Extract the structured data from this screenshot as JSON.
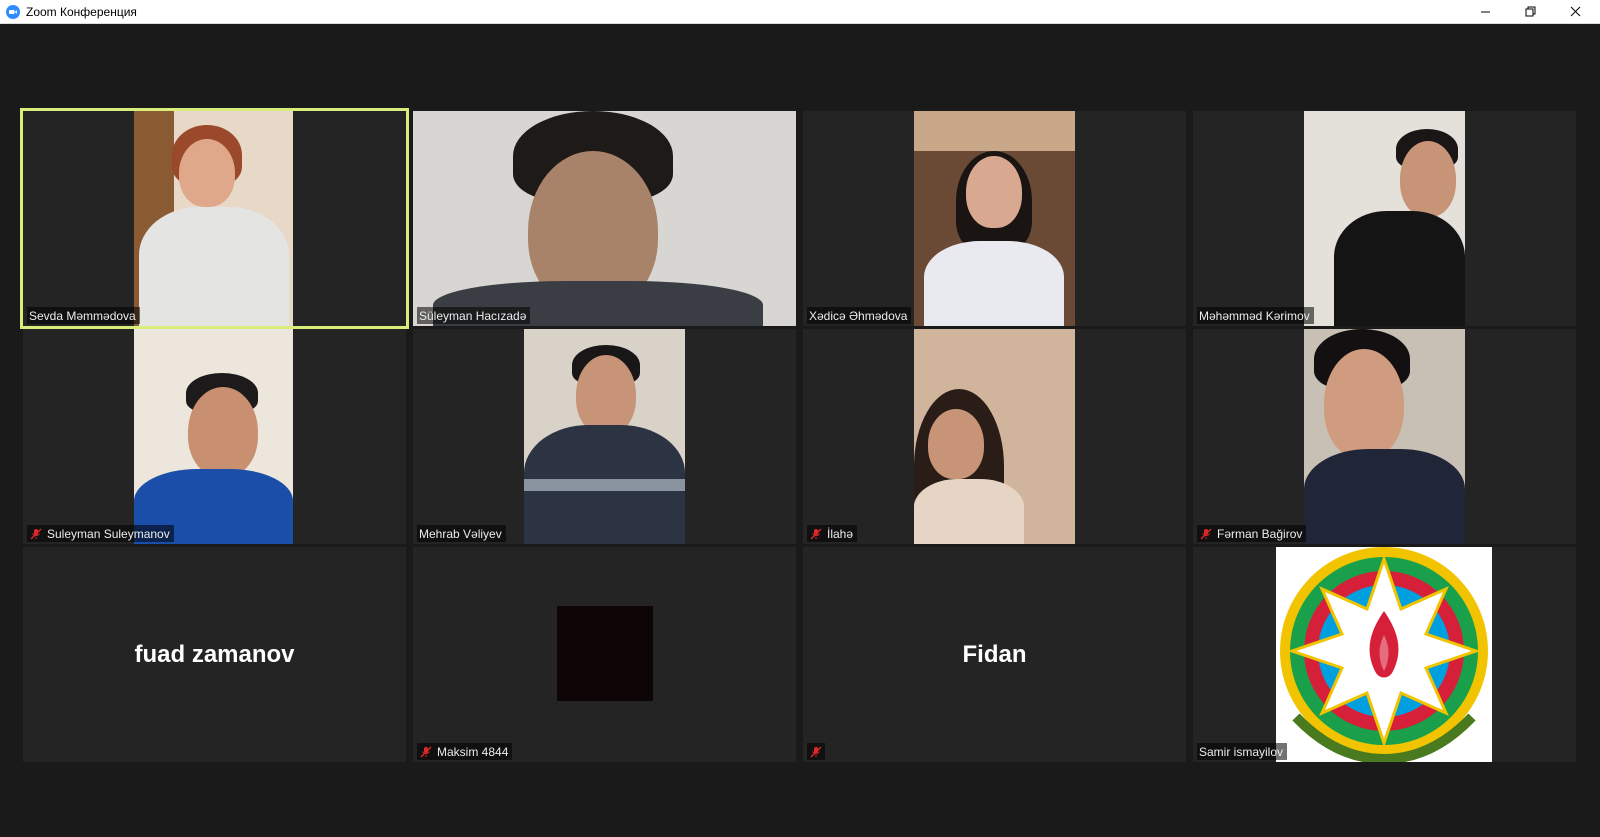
{
  "window": {
    "title": "Zoom Конференция",
    "controls": [
      "minimize-icon",
      "restore-icon",
      "close-icon"
    ]
  },
  "colors": {
    "active_speaker_border": "#d8ee7a",
    "mute_icon": "#e02828",
    "zoom_blue": "#2d8cff"
  },
  "participants": [
    {
      "name": "Sevda Məmmədova",
      "muted": false,
      "video": true,
      "active_speaker": true
    },
    {
      "name": "Süleyman Hacızadə",
      "muted": false,
      "video": true
    },
    {
      "name": "Xədicə Əhmədova",
      "muted": false,
      "video": true
    },
    {
      "name": "Məhəmməd Kərimov",
      "muted": false,
      "video": true
    },
    {
      "name": "Suleyman Suleymanov",
      "muted": true,
      "video": true
    },
    {
      "name": "Mehrab Vəliyev",
      "muted": false,
      "video": true
    },
    {
      "name": "İlahə",
      "muted": true,
      "video": true
    },
    {
      "name": "Fərman Bağirov",
      "muted": true,
      "video": true
    },
    {
      "name": "fuad zamanov",
      "muted": false,
      "video": false
    },
    {
      "name": "Maksim 4844",
      "muted": true,
      "video": true
    },
    {
      "name": "Fidan",
      "muted": true,
      "video": false
    },
    {
      "name": "Samir ismayilov",
      "muted": false,
      "video": true
    }
  ]
}
